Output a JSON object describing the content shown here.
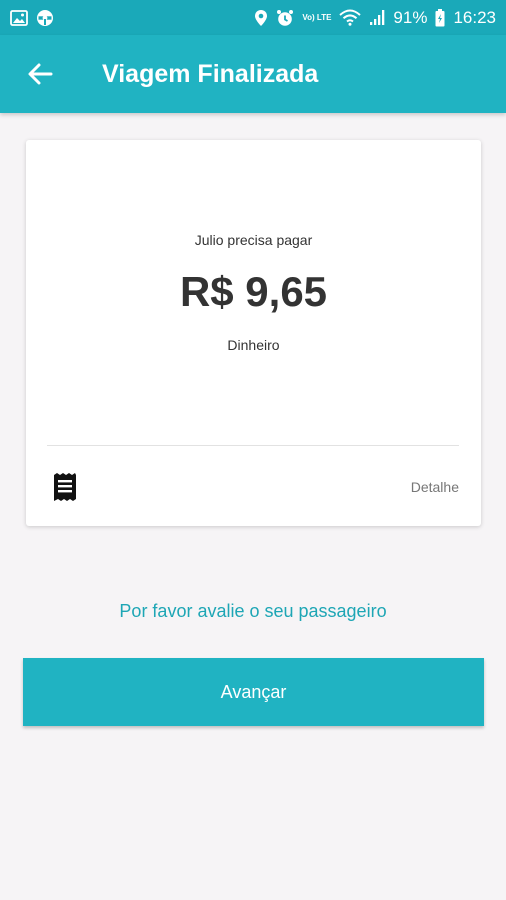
{
  "status_bar": {
    "battery": "91%",
    "time": "16:23",
    "volte": "Vo) LTE",
    "icons": [
      "image-icon",
      "steering-wheel-icon",
      "location-icon",
      "alarm-icon",
      "volte-icon",
      "wifi-icon",
      "signal-icon",
      "battery-icon"
    ]
  },
  "app_bar": {
    "title": "Viagem Finalizada",
    "back_icon": "arrow-back-icon"
  },
  "card": {
    "subtitle": "Julio precisa pagar",
    "amount": "R$ 9,65",
    "payment_method": "Dinheiro",
    "receipt_icon": "receipt-icon",
    "detail_label": "Detalhe"
  },
  "rate_prompt": "Por favor avalie o seu passageiro",
  "advance_button": "Avançar",
  "colors": {
    "primary": "#20b3c2",
    "accent_text": "#1ea6b5",
    "background": "#f6f4f6"
  }
}
